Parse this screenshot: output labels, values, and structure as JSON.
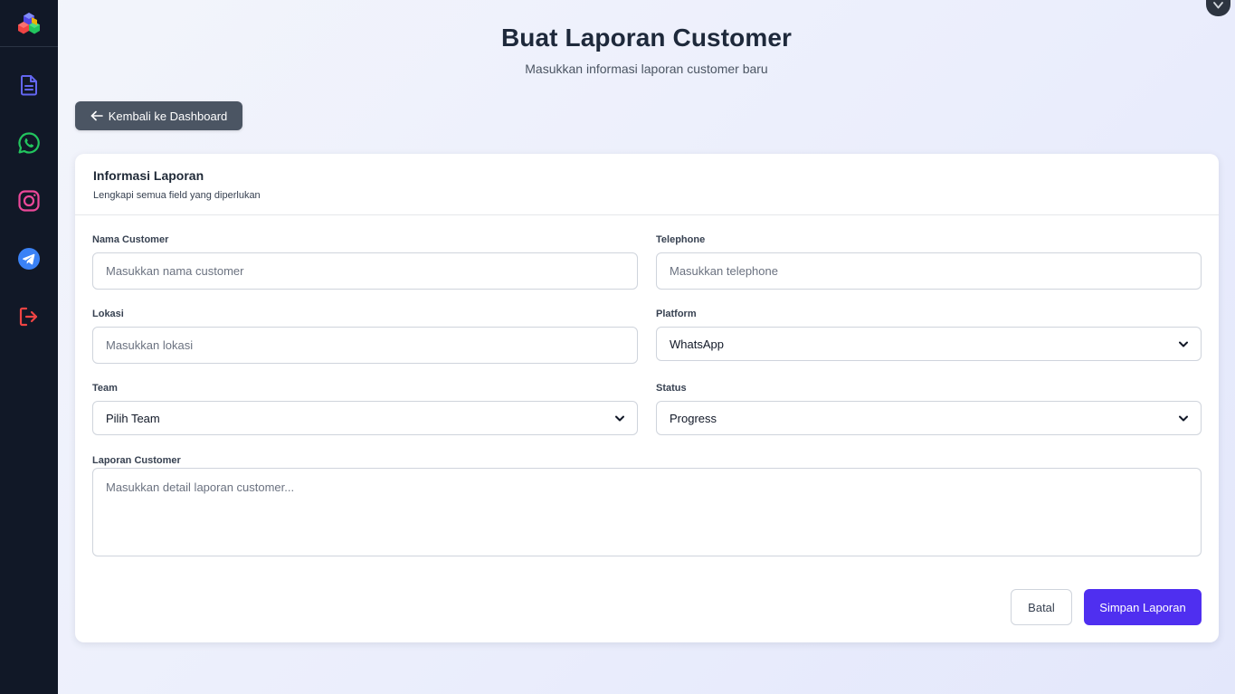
{
  "page": {
    "title": "Buat Laporan Customer",
    "subtitle": "Masukkan informasi laporan customer baru",
    "back_label": "Kembali ke Dashboard"
  },
  "sidebar": {
    "items": [
      {
        "name": "document-icon",
        "color": "#6366f1"
      },
      {
        "name": "whatsapp-icon",
        "color": "#22c55e"
      },
      {
        "name": "instagram-icon",
        "color": "#ec4899"
      },
      {
        "name": "telegram-icon",
        "color": "#3b82f6"
      },
      {
        "name": "logout-icon",
        "color": "#ef4444"
      }
    ]
  },
  "card": {
    "title": "Informasi Laporan",
    "subtitle": "Lengkapi semua field yang diperlukan"
  },
  "form": {
    "nama_customer": {
      "label": "Nama Customer",
      "placeholder": "Masukkan nama customer",
      "value": ""
    },
    "telephone": {
      "label": "Telephone",
      "placeholder": "Masukkan telephone",
      "value": ""
    },
    "lokasi": {
      "label": "Lokasi",
      "placeholder": "Masukkan lokasi",
      "value": ""
    },
    "platform": {
      "label": "Platform",
      "selected": "WhatsApp"
    },
    "team": {
      "label": "Team",
      "selected": "Pilih Team"
    },
    "status": {
      "label": "Status",
      "selected": "Progress"
    },
    "laporan": {
      "label": "Laporan Customer",
      "placeholder": "Masukkan detail laporan customer...",
      "value": ""
    }
  },
  "actions": {
    "cancel_label": "Batal",
    "save_label": "Simpan Laporan"
  },
  "colors": {
    "sidebar_bg": "#111827",
    "primary": "#4f2ff0",
    "back_button": "#4b5563"
  }
}
